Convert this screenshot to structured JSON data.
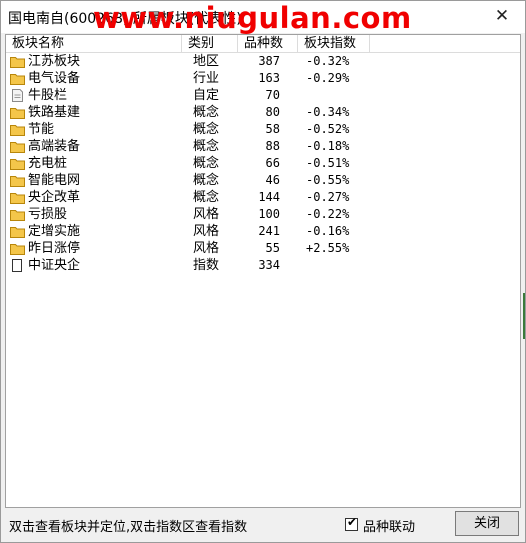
{
  "window": {
    "title": "国电南自(600268) 所属板块(代表性)",
    "watermark": "www.niugulan.com",
    "close_label": "✕"
  },
  "columns": [
    "板块名称",
    "类别",
    "品种数",
    "板块指数"
  ],
  "rows": [
    {
      "name": "江苏板块",
      "type": "地区",
      "count": "387",
      "index": "-0.32%",
      "icon": "folder-icon"
    },
    {
      "name": "电气设备",
      "type": "行业",
      "count": "163",
      "index": "-0.29%",
      "icon": "folder-icon"
    },
    {
      "name": "牛股栏",
      "type": "自定",
      "count": "70",
      "index": "",
      "icon": "document-icon"
    },
    {
      "name": "铁路基建",
      "type": "概念",
      "count": "80",
      "index": "-0.34%",
      "icon": "folder-icon"
    },
    {
      "name": "节能",
      "type": "概念",
      "count": "58",
      "index": "-0.52%",
      "icon": "folder-icon"
    },
    {
      "name": "高端装备",
      "type": "概念",
      "count": "88",
      "index": "-0.18%",
      "icon": "folder-icon"
    },
    {
      "name": "充电桩",
      "type": "概念",
      "count": "66",
      "index": "-0.51%",
      "icon": "folder-icon"
    },
    {
      "name": "智能电网",
      "type": "概念",
      "count": "46",
      "index": "-0.55%",
      "icon": "folder-icon"
    },
    {
      "name": "央企改革",
      "type": "概念",
      "count": "144",
      "index": "-0.27%",
      "icon": "folder-icon"
    },
    {
      "name": "亏损股",
      "type": "风格",
      "count": "100",
      "index": "-0.22%",
      "icon": "folder-icon"
    },
    {
      "name": "定增实施",
      "type": "风格",
      "count": "241",
      "index": "-0.16%",
      "icon": "folder-icon"
    },
    {
      "name": "昨日涨停",
      "type": "风格",
      "count": "55",
      "index": "+2.55%",
      "icon": "folder-icon"
    },
    {
      "name": "中证央企",
      "type": "指数",
      "count": "334",
      "index": "",
      "icon": "blank-page-icon"
    }
  ],
  "statusbar": {
    "hint": "双击查看板块并定位,双击指数区查看指数",
    "checkbox_label": "品种联动",
    "checkbox_checked": true,
    "close_button": "关闭"
  },
  "colors": {
    "folder": "#f4c64a",
    "watermark": "#f00000"
  }
}
